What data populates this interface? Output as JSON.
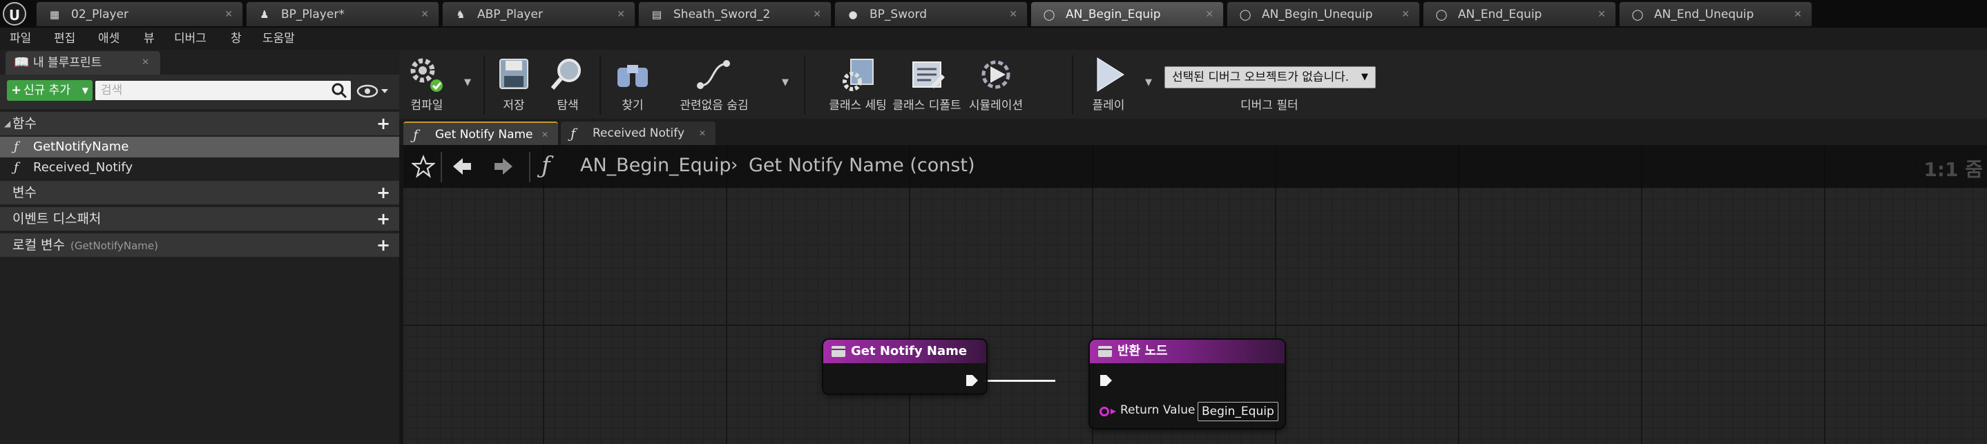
{
  "doc_tabs": [
    {
      "label": "02_Player",
      "icon": "level-icon"
    },
    {
      "label": "BP_Player*",
      "icon": "blueprint-icon"
    },
    {
      "label": "ABP_Player",
      "icon": "anim-blueprint-icon"
    },
    {
      "label": "Sheath_Sword_2",
      "icon": "montage-icon"
    },
    {
      "label": "BP_Sword",
      "icon": "actor-icon"
    },
    {
      "label": "AN_Begin_Equip",
      "icon": "anim-notify-icon"
    },
    {
      "label": "AN_Begin_Unequip",
      "icon": "anim-notify-icon"
    },
    {
      "label": "AN_End_Equip",
      "icon": "anim-notify-icon"
    },
    {
      "label": "AN_End_Unequip",
      "icon": "anim-notify-icon"
    }
  ],
  "menu": [
    "파일",
    "편집",
    "애셋",
    "뷰",
    "디버그",
    "창",
    "도움말"
  ],
  "left_panel": {
    "tab_label": "내 블루프린트",
    "add_button": "신규 추가",
    "search_placeholder": "검색",
    "sections": {
      "functions": "함수",
      "variables": "변수",
      "event_dispatchers": "이벤트 디스패처",
      "local_variables": "로컬 변수",
      "local_variables_scope": "(GetNotifyName)"
    },
    "functions": [
      {
        "label": "GetNotifyName",
        "selected": true
      },
      {
        "label": "Received_Notify",
        "selected": false
      }
    ]
  },
  "toolbar": {
    "compile": "컴파일",
    "save": "저장",
    "browse": "탐색",
    "find": "찾기",
    "hide_unrelated": "관련없음 숨김",
    "class_settings": "클래스 세팅",
    "class_defaults": "클래스 디폴트",
    "simulation": "시뮬레이션",
    "play": "플레이",
    "debug_select": "선택된 디버그 오브젝트가 없습니다.",
    "debug_filter": "디버그 필터"
  },
  "graph_tabs": [
    {
      "label": "Get Notify Name",
      "active": true
    },
    {
      "label": "Received Notify",
      "active": false
    }
  ],
  "breadcrumb": {
    "root": "AN_Begin_Equip",
    "current": "Get Notify Name (const)"
  },
  "zoom_label": "1:1 줌",
  "nodes": {
    "entry": {
      "title": "Get Notify Name"
    },
    "return": {
      "title": "반환 노드",
      "pin_label": "Return Value",
      "pin_value": "Begin_Equip"
    }
  },
  "colors": {
    "node_header": "#7a2384",
    "name_pin": "#d92cd9",
    "add_button": "#3fa144",
    "active_tab_accent": "#c89b2a"
  }
}
